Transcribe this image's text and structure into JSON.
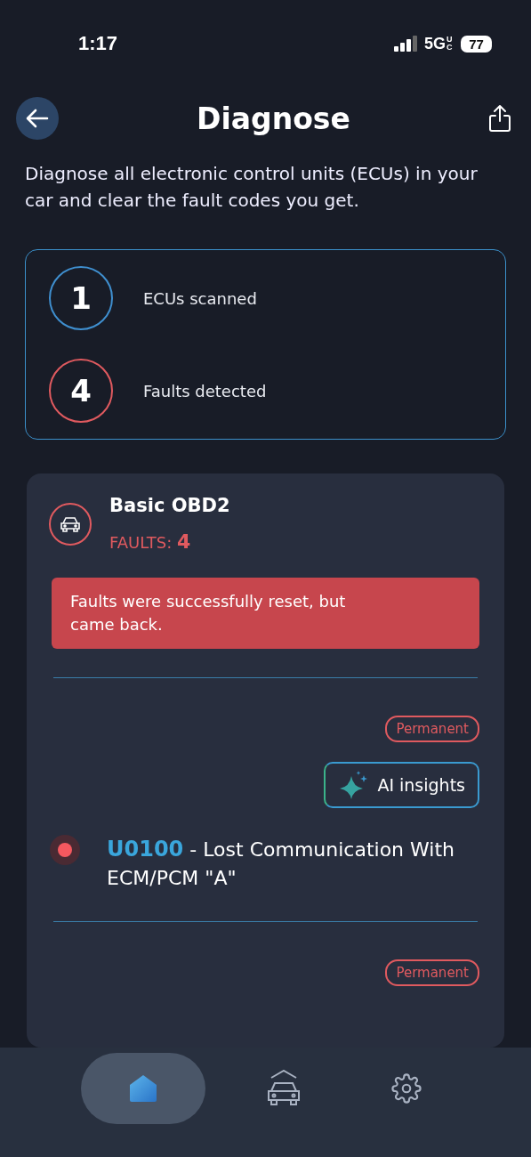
{
  "status_bar": {
    "time": "1:17",
    "network": "5G",
    "network_sub": "UC",
    "battery": "77"
  },
  "header": {
    "title": "Diagnose"
  },
  "description": "Diagnose all electronic control units (ECUs) in your car and clear the fault codes you get.",
  "summary": [
    {
      "value": "1",
      "label": "ECUs scanned",
      "color": "#3f8fcf"
    },
    {
      "value": "4",
      "label": "Faults detected",
      "color": "#e05a5f"
    }
  ],
  "ecu": {
    "name": "Basic OBD2",
    "faults_label": "FAULTS:",
    "faults_count": "4",
    "alert": "Faults were successfully reset, but came back.",
    "faults": [
      {
        "badge": "Permanent",
        "ai_button": "AI insights",
        "code": "U0100",
        "description": "- Lost Communication With ECM/PCM \"A\""
      },
      {
        "badge": "Permanent"
      }
    ]
  },
  "nav": [
    {
      "kind": "home",
      "selected": true
    },
    {
      "kind": "garage",
      "selected": false
    },
    {
      "kind": "settings",
      "selected": false
    }
  ]
}
